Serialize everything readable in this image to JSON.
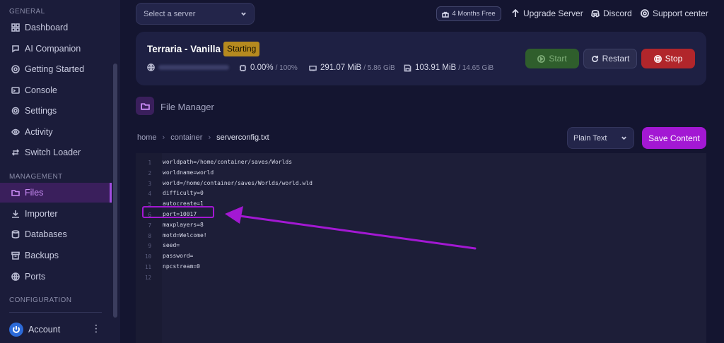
{
  "sidebar": {
    "sections": {
      "general": "GENERAL",
      "management": "MANAGEMENT",
      "configuration": "CONFIGURATION"
    },
    "items": [
      {
        "label": "Dashboard",
        "icon": "dashboard-icon"
      },
      {
        "label": "AI Companion",
        "icon": "chat-icon"
      },
      {
        "label": "Getting Started",
        "icon": "lifebuoy-icon"
      },
      {
        "label": "Console",
        "icon": "terminal-icon"
      },
      {
        "label": "Settings",
        "icon": "gear-icon"
      },
      {
        "label": "Activity",
        "icon": "eye-icon"
      },
      {
        "label": "Switch Loader",
        "icon": "switch-icon"
      },
      {
        "label": "Files",
        "icon": "folder-icon",
        "active": true
      },
      {
        "label": "Importer",
        "icon": "download-icon"
      },
      {
        "label": "Databases",
        "icon": "database-icon"
      },
      {
        "label": "Backups",
        "icon": "archive-icon"
      },
      {
        "label": "Ports",
        "icon": "globe-icon"
      }
    ],
    "account": {
      "label": "Account",
      "menu": "⋮"
    }
  },
  "header": {
    "server_select_placeholder": "Select a server",
    "promo": "4 Months Free",
    "links": {
      "upgrade": "Upgrade Server",
      "discord": "Discord",
      "support": "Support center"
    }
  },
  "server": {
    "name": "Terraria - Vanilla",
    "status": "Starting",
    "cpu": "0.00%",
    "cpu_max": "/ 100%",
    "memory": "291.07 MiB",
    "memory_max": "/ 5.86 GiB",
    "disk": "103.91 MiB",
    "disk_max": "/ 14.65 GiB",
    "buttons": {
      "start": "Start",
      "restart": "Restart",
      "stop": "Stop"
    }
  },
  "file_manager": {
    "title": "File Manager",
    "breadcrumb": [
      "home",
      "container",
      "serverconfig.txt"
    ],
    "language": "Plain Text",
    "save_label": "Save Content"
  },
  "editor": {
    "lines": [
      "worldpath=/home/container/saves/Worlds",
      "worldname=world",
      "world=/home/container/saves/Worlds/world.wld",
      "difficulty=0",
      "autocreate=1",
      "port=10017",
      "maxplayers=8",
      "motd=Welcome!",
      "seed=",
      "password=",
      "npcstream=0",
      ""
    ],
    "line_numbers": [
      "1",
      "2",
      "3",
      "4",
      "5",
      "6",
      "7",
      "8",
      "9",
      "10",
      "11",
      "12"
    ]
  },
  "colors": {
    "accent": "#a318d3",
    "start": "#2f5e2c",
    "stop": "#b1262b",
    "status_badge": "#b68a1f"
  }
}
